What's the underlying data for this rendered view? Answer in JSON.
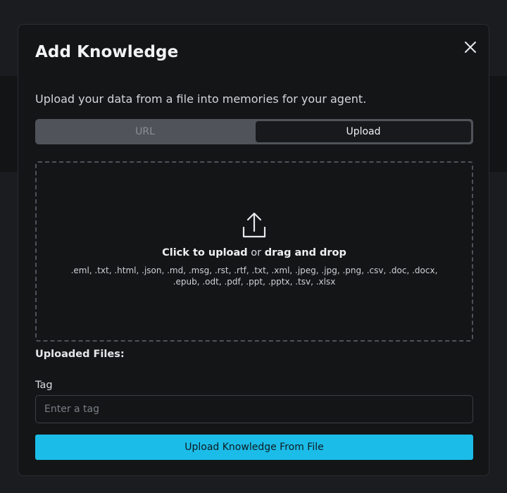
{
  "modal": {
    "title": "Add Knowledge",
    "subtitle": "Upload your data from a file into memories for your agent."
  },
  "tabs": [
    {
      "label": "URL",
      "active": false
    },
    {
      "label": "Upload",
      "active": true
    }
  ],
  "dropzone": {
    "click_text": "Click to upload",
    "or_text": " or ",
    "drag_text": "drag and drop",
    "formats": ".eml, .txt, .html, .json, .md, .msg, .rst, .rtf, .txt, .xml, .jpeg, .jpg, .png, .csv, .doc, .docx, .epub, .odt, .pdf, .ppt, .pptx, .tsv, .xlsx"
  },
  "uploaded_files": {
    "label": "Uploaded Files:"
  },
  "tag": {
    "label": "Tag",
    "value": "",
    "placeholder": "Enter a tag"
  },
  "submit": {
    "label": "Upload Knowledge From File"
  },
  "colors": {
    "accent": "#1bbde8",
    "modal_bg": "#131517",
    "tab_track": "#50545a"
  },
  "icons": {
    "close": "close-icon",
    "upload": "upload-icon"
  }
}
